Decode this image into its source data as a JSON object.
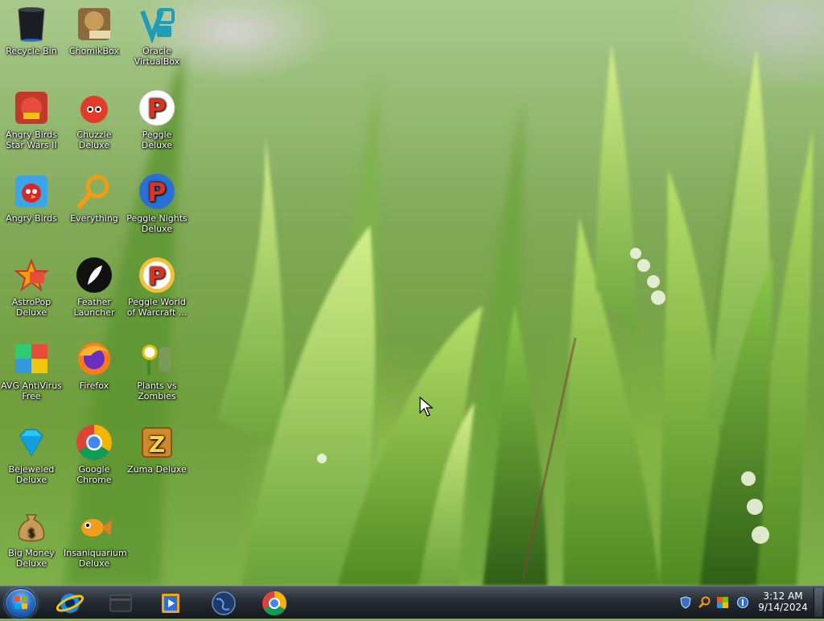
{
  "desktop": {
    "icons": [
      {
        "label": "Recycle Bin"
      },
      {
        "label": "ChomikBox"
      },
      {
        "label": "Oracle VirtualBox"
      },
      {
        "label": "Angry Birds Star Wars II"
      },
      {
        "label": "Chuzzle Deluxe"
      },
      {
        "label": "Peggle Deluxe"
      },
      {
        "label": "Angry Birds"
      },
      {
        "label": "Everything"
      },
      {
        "label": "Peggle Nights Deluxe"
      },
      {
        "label": "AstroPop Deluxe"
      },
      {
        "label": "Feather Launcher"
      },
      {
        "label": "Peggle World of Warcraft ..."
      },
      {
        "label": "AVG AntiVirus Free"
      },
      {
        "label": "Firefox"
      },
      {
        "label": "Plants vs Zombies"
      },
      {
        "label": "Bejeweled Deluxe"
      },
      {
        "label": "Google Chrome"
      },
      {
        "label": "Zuma Deluxe"
      },
      {
        "label": "Big Money Deluxe"
      },
      {
        "label": "Insaniquarium Deluxe"
      }
    ]
  },
  "taskbar": {
    "pinned": [
      "start-orb",
      "internet-explorer-icon",
      "file-explorer-icon",
      "media-player-icon",
      "globe-app-icon",
      "google-chrome-icon"
    ],
    "tray_icons": [
      "security-shield-icon",
      "search-icon",
      "colorful-app-icon",
      "network-icon"
    ],
    "clock": {
      "time": "3:12 AM",
      "date": "9/14/2024"
    }
  },
  "colors": {
    "taskbar_top": "#4c5560",
    "taskbar_bottom": "#161a1f",
    "wallpaper_green": "#6f9e3c"
  }
}
